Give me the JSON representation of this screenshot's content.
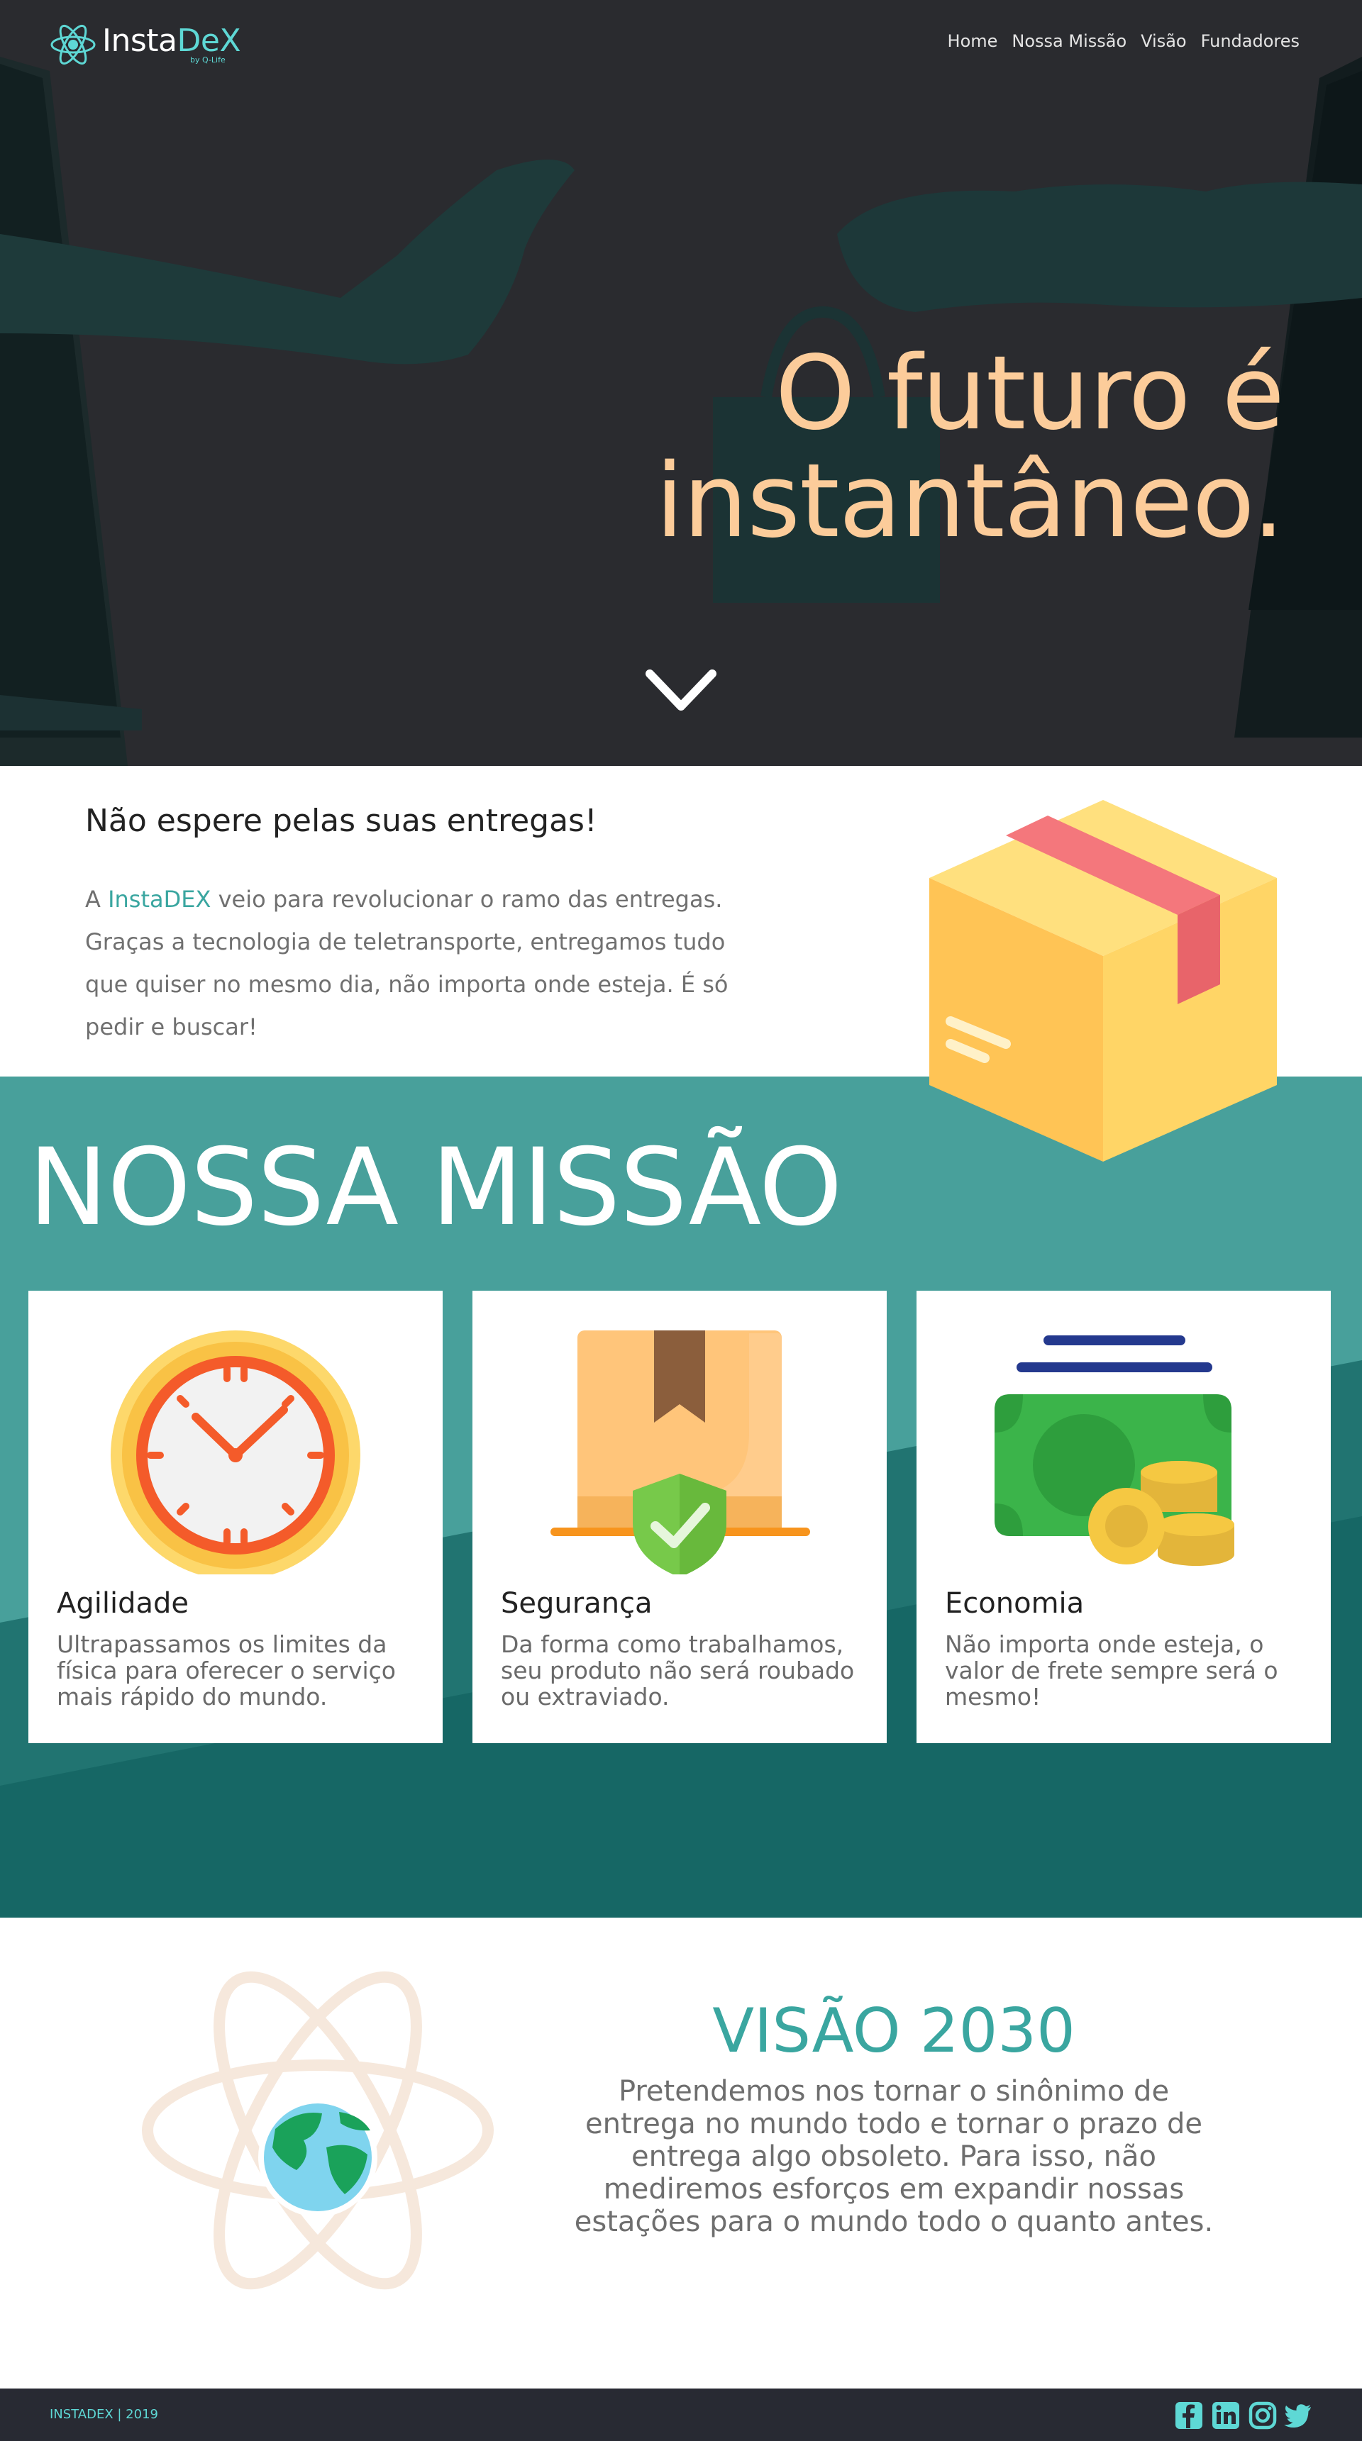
{
  "brand": {
    "name_part1": "Insta",
    "name_part2": "DeX",
    "tagline": "by Q-Life"
  },
  "nav": {
    "items": [
      {
        "label": "Home"
      },
      {
        "label": "Nossa Missão"
      },
      {
        "label": "Visão"
      },
      {
        "label": "Fundadores"
      }
    ]
  },
  "hero": {
    "title_line1": "O futuro é",
    "title_line2": "instantâneo.",
    "scroll_icon": "chevron-down-icon"
  },
  "intro": {
    "title": "Não espere pelas suas entregas!",
    "text_prefix": "A ",
    "brand_word": "InstaDEX",
    "text_rest": " veio para revolucionar o ramo das entregas. Graças a tecnologia de teletransporte, entregamos tudo que quiser no mesmo dia, não importa onde esteja. É só pedir e buscar!"
  },
  "mission": {
    "title": "NOSSA MISSÃO",
    "cards": [
      {
        "icon": "clock-icon",
        "title": "Agilidade",
        "text": "Ultrapassamos os limites da física para oferecer o serviço mais rápido do mundo."
      },
      {
        "icon": "shield-check-icon",
        "title": "Segurança",
        "text": "Da forma como trabalhamos, seu produto não será roubado ou extraviado."
      },
      {
        "icon": "money-icon",
        "title": "Economia",
        "text": "Não importa onde esteja, o valor de frete sempre será o mesmo!"
      }
    ]
  },
  "vision": {
    "title": "VISÃO 2030",
    "text": "Pretendemos nos tornar o sinônimo de entrega no mundo todo e tornar o prazo de entrega algo obsoleto. Para isso, não mediremos esforços em expandir nossas estações para o mundo todo o quanto antes."
  },
  "footer": {
    "copyright": "INSTADEX | 2019",
    "social": [
      "facebook-icon",
      "linkedin-icon",
      "instagram-icon",
      "twitter-icon"
    ]
  },
  "colors": {
    "accent": "#3aa6a0",
    "accent_light": "#5ed8d5",
    "hero_text": "#fccc9a",
    "hero_bg": "#2a2b2f",
    "mission_top": "#48a09b",
    "mission_bottom": "#156664",
    "footer_bg": "#282a33"
  }
}
